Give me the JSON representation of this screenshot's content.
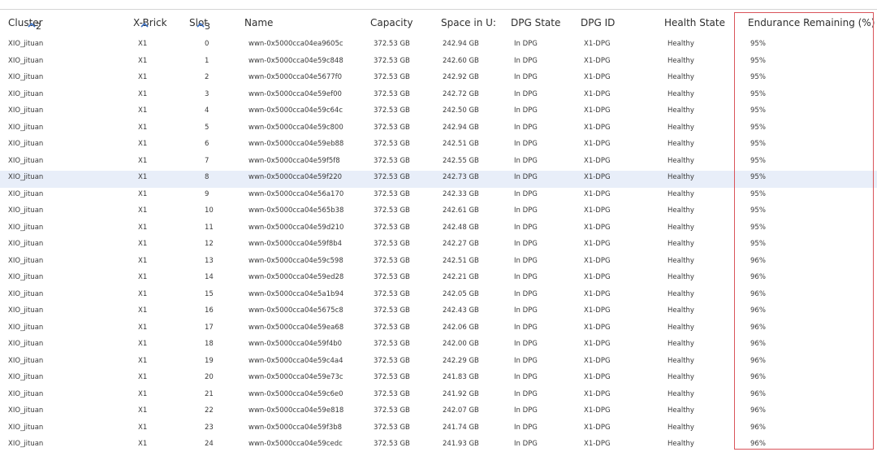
{
  "table": {
    "columns": [
      {
        "key": "cluster",
        "label": "Cluster",
        "sort_order": "2"
      },
      {
        "key": "xbrick",
        "label": "X-Brick",
        "sort_order": ""
      },
      {
        "key": "slot",
        "label": "Slot",
        "sort_order": "3"
      },
      {
        "key": "name",
        "label": "Name"
      },
      {
        "key": "capacity",
        "label": "Capacity"
      },
      {
        "key": "space",
        "label": "Space in U:"
      },
      {
        "key": "dpg_state",
        "label": "DPG State"
      },
      {
        "key": "dpg_id",
        "label": "DPG ID"
      },
      {
        "key": "health",
        "label": "Health State"
      },
      {
        "key": "endurance",
        "label": "Endurance Remaining (%)"
      }
    ],
    "selected_row_index": 8,
    "highlight_color": "#d9545a",
    "selected_row_color": "#e8eef9",
    "rows": [
      {
        "cluster": "XIO_jituan",
        "xbrick": "X1",
        "slot": "0",
        "name": "wwn-0x5000cca04ea9605c",
        "capacity": "372.53 GB",
        "space": "242.94 GB",
        "dpg_state": "In DPG",
        "dpg_id": "X1-DPG",
        "health": "Healthy",
        "endurance": "95%"
      },
      {
        "cluster": "XIO_jituan",
        "xbrick": "X1",
        "slot": "1",
        "name": "wwn-0x5000cca04e59c848",
        "capacity": "372.53 GB",
        "space": "242.60 GB",
        "dpg_state": "In DPG",
        "dpg_id": "X1-DPG",
        "health": "Healthy",
        "endurance": "95%"
      },
      {
        "cluster": "XIO_jituan",
        "xbrick": "X1",
        "slot": "2",
        "name": "wwn-0x5000cca04e5677f0",
        "capacity": "372.53 GB",
        "space": "242.92 GB",
        "dpg_state": "In DPG",
        "dpg_id": "X1-DPG",
        "health": "Healthy",
        "endurance": "95%"
      },
      {
        "cluster": "XIO_jituan",
        "xbrick": "X1",
        "slot": "3",
        "name": "wwn-0x5000cca04e59ef00",
        "capacity": "372.53 GB",
        "space": "242.72 GB",
        "dpg_state": "In DPG",
        "dpg_id": "X1-DPG",
        "health": "Healthy",
        "endurance": "95%"
      },
      {
        "cluster": "XIO_jituan",
        "xbrick": "X1",
        "slot": "4",
        "name": "wwn-0x5000cca04e59c64c",
        "capacity": "372.53 GB",
        "space": "242.50 GB",
        "dpg_state": "In DPG",
        "dpg_id": "X1-DPG",
        "health": "Healthy",
        "endurance": "95%"
      },
      {
        "cluster": "XIO_jituan",
        "xbrick": "X1",
        "slot": "5",
        "name": "wwn-0x5000cca04e59c800",
        "capacity": "372.53 GB",
        "space": "242.94 GB",
        "dpg_state": "In DPG",
        "dpg_id": "X1-DPG",
        "health": "Healthy",
        "endurance": "95%"
      },
      {
        "cluster": "XIO_jituan",
        "xbrick": "X1",
        "slot": "6",
        "name": "wwn-0x5000cca04e59eb88",
        "capacity": "372.53 GB",
        "space": "242.51 GB",
        "dpg_state": "In DPG",
        "dpg_id": "X1-DPG",
        "health": "Healthy",
        "endurance": "95%"
      },
      {
        "cluster": "XIO_jituan",
        "xbrick": "X1",
        "slot": "7",
        "name": "wwn-0x5000cca04e59f5f8",
        "capacity": "372.53 GB",
        "space": "242.55 GB",
        "dpg_state": "In DPG",
        "dpg_id": "X1-DPG",
        "health": "Healthy",
        "endurance": "95%"
      },
      {
        "cluster": "XIO_jituan",
        "xbrick": "X1",
        "slot": "8",
        "name": "wwn-0x5000cca04e59f220",
        "capacity": "372.53 GB",
        "space": "242.73 GB",
        "dpg_state": "In DPG",
        "dpg_id": "X1-DPG",
        "health": "Healthy",
        "endurance": "95%"
      },
      {
        "cluster": "XIO_jituan",
        "xbrick": "X1",
        "slot": "9",
        "name": "wwn-0x5000cca04e56a170",
        "capacity": "372.53 GB",
        "space": "242.33 GB",
        "dpg_state": "In DPG",
        "dpg_id": "X1-DPG",
        "health": "Healthy",
        "endurance": "95%"
      },
      {
        "cluster": "XIO_jituan",
        "xbrick": "X1",
        "slot": "10",
        "name": "wwn-0x5000cca04e565b38",
        "capacity": "372.53 GB",
        "space": "242.61 GB",
        "dpg_state": "In DPG",
        "dpg_id": "X1-DPG",
        "health": "Healthy",
        "endurance": "95%"
      },
      {
        "cluster": "XIO_jituan",
        "xbrick": "X1",
        "slot": "11",
        "name": "wwn-0x5000cca04e59d210",
        "capacity": "372.53 GB",
        "space": "242.48 GB",
        "dpg_state": "In DPG",
        "dpg_id": "X1-DPG",
        "health": "Healthy",
        "endurance": "95%"
      },
      {
        "cluster": "XIO_jituan",
        "xbrick": "X1",
        "slot": "12",
        "name": "wwn-0x5000cca04e59f8b4",
        "capacity": "372.53 GB",
        "space": "242.27 GB",
        "dpg_state": "In DPG",
        "dpg_id": "X1-DPG",
        "health": "Healthy",
        "endurance": "95%"
      },
      {
        "cluster": "XIO_jituan",
        "xbrick": "X1",
        "slot": "13",
        "name": "wwn-0x5000cca04e59c598",
        "capacity": "372.53 GB",
        "space": "242.51 GB",
        "dpg_state": "In DPG",
        "dpg_id": "X1-DPG",
        "health": "Healthy",
        "endurance": "96%"
      },
      {
        "cluster": "XIO_jituan",
        "xbrick": "X1",
        "slot": "14",
        "name": "wwn-0x5000cca04e59ed28",
        "capacity": "372.53 GB",
        "space": "242.21 GB",
        "dpg_state": "In DPG",
        "dpg_id": "X1-DPG",
        "health": "Healthy",
        "endurance": "96%"
      },
      {
        "cluster": "XIO_jituan",
        "xbrick": "X1",
        "slot": "15",
        "name": "wwn-0x5000cca04e5a1b94",
        "capacity": "372.53 GB",
        "space": "242.05 GB",
        "dpg_state": "In DPG",
        "dpg_id": "X1-DPG",
        "health": "Healthy",
        "endurance": "96%"
      },
      {
        "cluster": "XIO_jituan",
        "xbrick": "X1",
        "slot": "16",
        "name": "wwn-0x5000cca04e5675c8",
        "capacity": "372.53 GB",
        "space": "242.43 GB",
        "dpg_state": "In DPG",
        "dpg_id": "X1-DPG",
        "health": "Healthy",
        "endurance": "96%"
      },
      {
        "cluster": "XIO_jituan",
        "xbrick": "X1",
        "slot": "17",
        "name": "wwn-0x5000cca04e59ea68",
        "capacity": "372.53 GB",
        "space": "242.06 GB",
        "dpg_state": "In DPG",
        "dpg_id": "X1-DPG",
        "health": "Healthy",
        "endurance": "96%"
      },
      {
        "cluster": "XIO_jituan",
        "xbrick": "X1",
        "slot": "18",
        "name": "wwn-0x5000cca04e59f4b0",
        "capacity": "372.53 GB",
        "space": "242.00 GB",
        "dpg_state": "In DPG",
        "dpg_id": "X1-DPG",
        "health": "Healthy",
        "endurance": "96%"
      },
      {
        "cluster": "XIO_jituan",
        "xbrick": "X1",
        "slot": "19",
        "name": "wwn-0x5000cca04e59c4a4",
        "capacity": "372.53 GB",
        "space": "242.29 GB",
        "dpg_state": "In DPG",
        "dpg_id": "X1-DPG",
        "health": "Healthy",
        "endurance": "96%"
      },
      {
        "cluster": "XIO_jituan",
        "xbrick": "X1",
        "slot": "20",
        "name": "wwn-0x5000cca04e59e73c",
        "capacity": "372.53 GB",
        "space": "241.83 GB",
        "dpg_state": "In DPG",
        "dpg_id": "X1-DPG",
        "health": "Healthy",
        "endurance": "96%"
      },
      {
        "cluster": "XIO_jituan",
        "xbrick": "X1",
        "slot": "21",
        "name": "wwn-0x5000cca04e59c6e0",
        "capacity": "372.53 GB",
        "space": "241.92 GB",
        "dpg_state": "In DPG",
        "dpg_id": "X1-DPG",
        "health": "Healthy",
        "endurance": "96%"
      },
      {
        "cluster": "XIO_jituan",
        "xbrick": "X1",
        "slot": "22",
        "name": "wwn-0x5000cca04e59e818",
        "capacity": "372.53 GB",
        "space": "242.07 GB",
        "dpg_state": "In DPG",
        "dpg_id": "X1-DPG",
        "health": "Healthy",
        "endurance": "96%"
      },
      {
        "cluster": "XIO_jituan",
        "xbrick": "X1",
        "slot": "23",
        "name": "wwn-0x5000cca04e59f3b8",
        "capacity": "372.53 GB",
        "space": "241.74 GB",
        "dpg_state": "In DPG",
        "dpg_id": "X1-DPG",
        "health": "Healthy",
        "endurance": "96%"
      },
      {
        "cluster": "XIO_jituan",
        "xbrick": "X1",
        "slot": "24",
        "name": "wwn-0x5000cca04e59cedc",
        "capacity": "372.53 GB",
        "space": "241.93 GB",
        "dpg_state": "In DPG",
        "dpg_id": "X1-DPG",
        "health": "Healthy",
        "endurance": "96%"
      }
    ]
  }
}
